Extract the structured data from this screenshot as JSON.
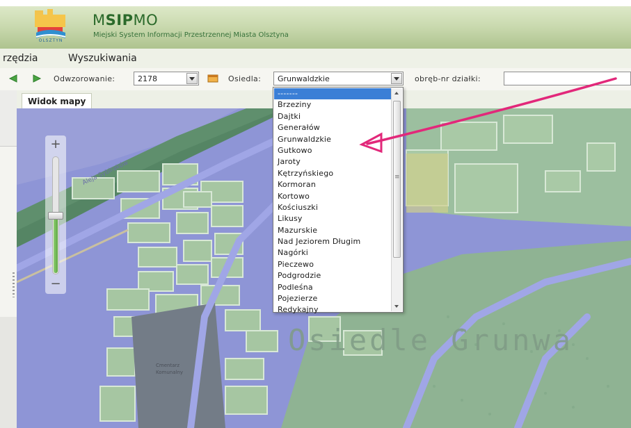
{
  "header": {
    "title_part1": "M",
    "title_part2": "SIP",
    "title_part3": "MO",
    "subtitle": "Miejski System Informacji Przestrzennej Miasta Olsztyna",
    "logo_text": "OLSZTYN"
  },
  "menu": {
    "items": [
      "rzędzia",
      "Wyszukiwania"
    ]
  },
  "toolbar": {
    "projection_label": "Odwzorowanie:",
    "projection_value": "2178",
    "district_label": "Osiedla:",
    "district_value": "Grunwaldzkie",
    "parcel_label": "obręb-nr działki:",
    "parcel_value": ""
  },
  "tabs": {
    "map_view": "Widok mapy"
  },
  "map": {
    "street_label": "Aleja Sybiraków",
    "district_overlay": "Osiedle Grunwa",
    "cemetery_label_1": "Cmentarz",
    "cemetery_label_2": "Komunalny"
  },
  "zoom": {
    "plus": "+",
    "minus": "−",
    "level": 0.5
  },
  "dropdown": {
    "items": [
      "-------",
      "Brzeziny",
      "Dajtki",
      "Generałów",
      "Grunwaldzkie",
      "Gutkowo",
      "Jaroty",
      "Kętrzyńskiego",
      "Kormoran",
      "Kortowo",
      "Kościuszki",
      "Likusy",
      "Mazurskie",
      "Nad Jeziorem Długim",
      "Nagórki",
      "Pieczewo",
      "Podgrodzie",
      "Podleśna",
      "Pojezierze",
      "Redykajny"
    ],
    "selected_index": 0
  },
  "colors": {
    "header_green": "#c9d9ae",
    "map_parcel": "#a9c8a4",
    "map_road": "#8f93d8",
    "annotation_arrow": "#e2287a",
    "dropdown_selected": "#3b7fd6"
  }
}
